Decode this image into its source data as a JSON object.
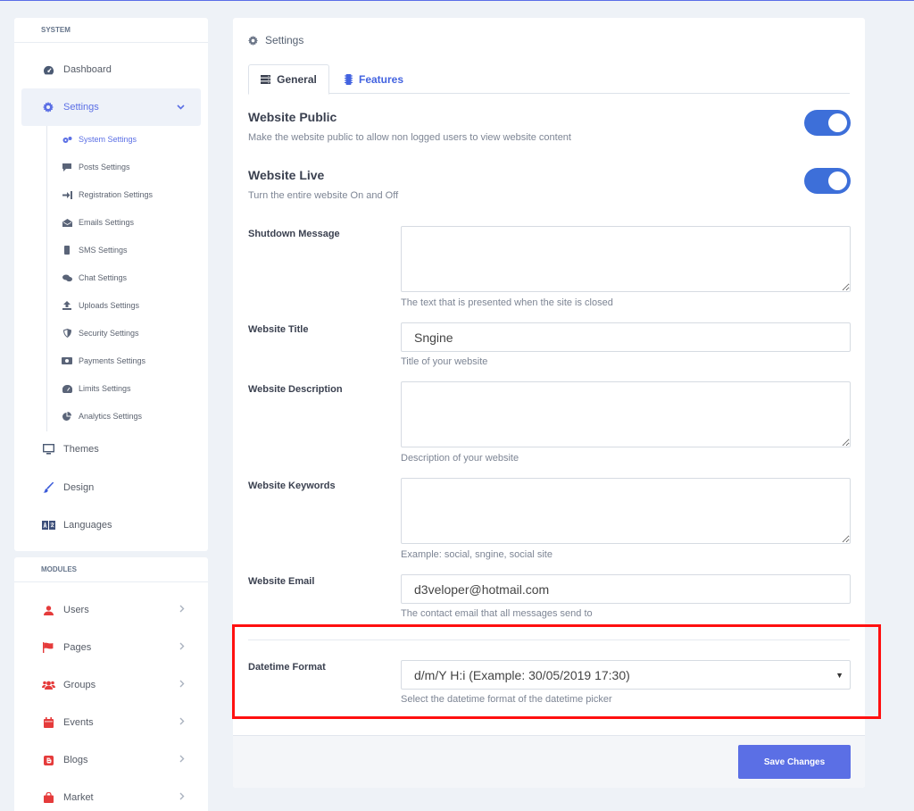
{
  "sidebar": {
    "system_title": "SYSTEM",
    "modules_title": "MODULES",
    "items": [
      {
        "label": "Dashboard",
        "icon": "dashboard-icon"
      },
      {
        "label": "Settings",
        "icon": "gear-icon"
      },
      {
        "label": "Themes",
        "icon": "monitor-icon"
      },
      {
        "label": "Design",
        "icon": "brush-icon"
      },
      {
        "label": "Languages",
        "icon": "translate-icon"
      }
    ],
    "subitems": [
      {
        "label": "System Settings",
        "icon": "cogs-icon"
      },
      {
        "label": "Posts Settings",
        "icon": "comment-icon"
      },
      {
        "label": "Registration Settings",
        "icon": "sign-in-icon"
      },
      {
        "label": "Emails Settings",
        "icon": "envelope-open-icon"
      },
      {
        "label": "SMS Settings",
        "icon": "mobile-icon"
      },
      {
        "label": "Chat Settings",
        "icon": "chat-icon"
      },
      {
        "label": "Uploads Settings",
        "icon": "upload-icon"
      },
      {
        "label": "Security Settings",
        "icon": "shield-icon"
      },
      {
        "label": "Payments Settings",
        "icon": "money-icon"
      },
      {
        "label": "Limits Settings",
        "icon": "gauge-icon"
      },
      {
        "label": "Analytics Settings",
        "icon": "pie-chart-icon"
      }
    ],
    "modules": [
      {
        "label": "Users",
        "icon": "user-icon"
      },
      {
        "label": "Pages",
        "icon": "flag-icon"
      },
      {
        "label": "Groups",
        "icon": "users-icon"
      },
      {
        "label": "Events",
        "icon": "calendar-icon"
      },
      {
        "label": "Blogs",
        "icon": "blogger-icon"
      },
      {
        "label": "Market",
        "icon": "shopping-bag-icon"
      }
    ]
  },
  "main": {
    "header": "Settings",
    "tabs": [
      {
        "label": "General",
        "icon": "server-icon"
      },
      {
        "label": "Features",
        "icon": "microchip-icon"
      }
    ],
    "website_public": {
      "title": "Website Public",
      "desc": "Make the website public to allow non logged users to view website content",
      "on": true
    },
    "website_live": {
      "title": "Website Live",
      "desc": "Turn the entire website On and Off",
      "on": true
    },
    "shutdown_message": {
      "label": "Shutdown Message",
      "value": "",
      "help": "The text that is presented when the site is closed"
    },
    "website_title": {
      "label": "Website Title",
      "value": "Sngine",
      "help": "Title of your website"
    },
    "website_description": {
      "label": "Website Description",
      "value": "",
      "help": "Description of your website"
    },
    "website_keywords": {
      "label": "Website Keywords",
      "value": "",
      "help": "Example: social, sngine, social site"
    },
    "website_email": {
      "label": "Website Email",
      "value": "d3veloper@hotmail.com",
      "help": "The contact email that all messages send to"
    },
    "datetime_format": {
      "label": "Datetime Format",
      "value": "d/m/Y H:i (Example: 30/05/2019 17:30)",
      "help": "Select the datetime format of the datetime picker"
    },
    "save_label": "Save Changes"
  },
  "colors": {
    "accent": "#5b6fe5",
    "switch": "#3d6fd9",
    "module_icon": "#e53b3b",
    "highlight": "#ff1010"
  }
}
